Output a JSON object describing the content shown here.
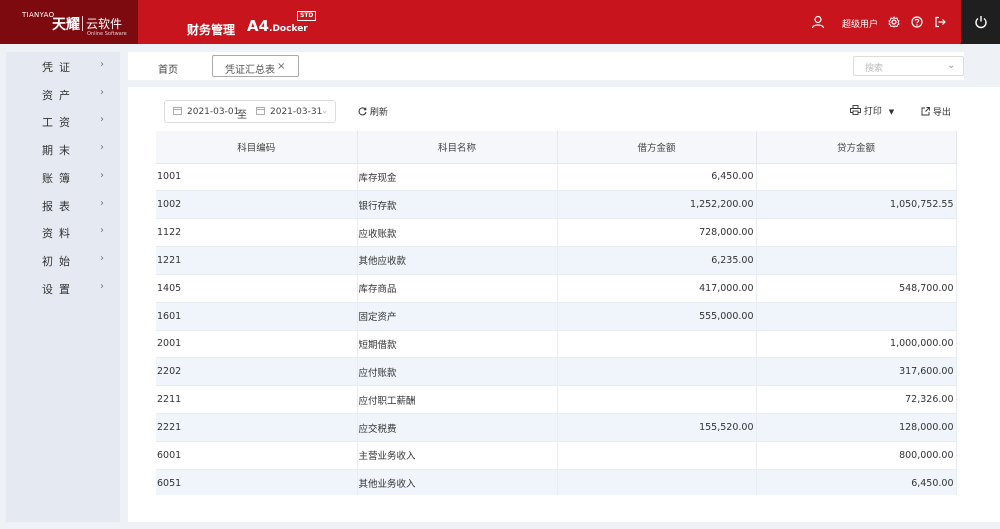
{
  "header": {
    "logo_small": "TIANYAO",
    "logo_main": "天耀",
    "logo_cloud": "云软件",
    "logo_sub": "Online Software",
    "app_title": "财务管理",
    "product_a4": "A4",
    "product_docker": ".Docker",
    "product_badge": "STD",
    "user_name": "超级用户",
    "colors": {
      "bar": "#c8151d",
      "logo_bg": "#7d0a0f",
      "power_bg": "#1f1f1f"
    },
    "icons": [
      "user-icon",
      "settings-icon",
      "help-icon",
      "exit-icon",
      "power-icon"
    ]
  },
  "sidebar": {
    "items": [
      {
        "label": "凭证"
      },
      {
        "label": "资产"
      },
      {
        "label": "工资"
      },
      {
        "label": "期末"
      },
      {
        "label": "账簿"
      },
      {
        "label": "报表"
      },
      {
        "label": "资料"
      },
      {
        "label": "初始"
      },
      {
        "label": "设置"
      }
    ],
    "arrow": "›"
  },
  "tabs": {
    "home": "首页",
    "active": "凭证汇总表",
    "close": "×"
  },
  "search": {
    "placeholder": "搜索"
  },
  "toolbar": {
    "date_start": "2021-03-01",
    "date_sep": "至",
    "date_end": "2021-03-31",
    "refresh": "刷新",
    "print": "打印",
    "export": "导出"
  },
  "table": {
    "columns": [
      "科目编码",
      "科目名称",
      "借方金额",
      "贷方金额"
    ],
    "rows": [
      {
        "code": "1001",
        "name": "库存现金",
        "debit": "6,450.00",
        "credit": ""
      },
      {
        "code": "1002",
        "name": "银行存款",
        "debit": "1,252,200.00",
        "credit": "1,050,752.55"
      },
      {
        "code": "1122",
        "name": "应收账款",
        "debit": "728,000.00",
        "credit": ""
      },
      {
        "code": "1221",
        "name": "其他应收款",
        "debit": "6,235.00",
        "credit": ""
      },
      {
        "code": "1405",
        "name": "库存商品",
        "debit": "417,000.00",
        "credit": "548,700.00"
      },
      {
        "code": "1601",
        "name": "固定资产",
        "debit": "555,000.00",
        "credit": ""
      },
      {
        "code": "2001",
        "name": "短期借款",
        "debit": "",
        "credit": "1,000,000.00"
      },
      {
        "code": "2202",
        "name": "应付账款",
        "debit": "",
        "credit": "317,600.00"
      },
      {
        "code": "2211",
        "name": "应付职工薪酬",
        "debit": "",
        "credit": "72,326.00"
      },
      {
        "code": "2221",
        "name": "应交税费",
        "debit": "155,520.00",
        "credit": "128,000.00"
      },
      {
        "code": "6001",
        "name": "主营业务收入",
        "debit": "",
        "credit": "800,000.00"
      },
      {
        "code": "6051",
        "name": "其他业务收入",
        "debit": "",
        "credit": "6,450.00"
      }
    ]
  }
}
